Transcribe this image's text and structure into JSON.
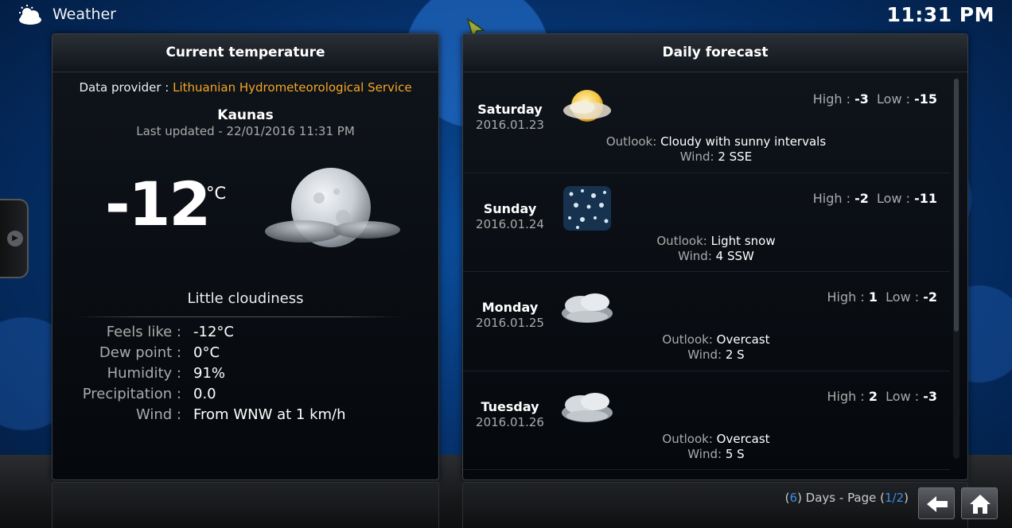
{
  "app": {
    "title": "Weather",
    "clock": "11:31 PM"
  },
  "current": {
    "panel_title": "Current temperature",
    "provider_label": "Data provider :",
    "provider_value": "Lithuanian Hydrometeorological Service",
    "city": "Kaunas",
    "last_updated": "Last updated - 22/01/2016 11:31 PM",
    "temperature": "-12",
    "unit": "°C",
    "condition": "Little cloudiness",
    "icon": "moon-cloud-icon",
    "details": [
      {
        "label": "Feels like :",
        "value": "-12°C"
      },
      {
        "label": "Dew point :",
        "value": "0°C"
      },
      {
        "label": "Humidity :",
        "value": "91%"
      },
      {
        "label": "Precipitation :",
        "value": "0.0"
      },
      {
        "label": "Wind :",
        "value": "From WNW at 1 km/h"
      }
    ]
  },
  "forecast": {
    "panel_title": "Daily forecast",
    "high_label": "High :",
    "low_label": "Low :",
    "outlook_label": "Outlook:",
    "wind_label": "Wind:",
    "days": [
      {
        "day": "Saturday",
        "date": "2016.01.23",
        "high": "-3",
        "low": "-15",
        "outlook": "Cloudy with sunny intervals",
        "wind": "2 SSE",
        "icon": "sun-cloud-icon"
      },
      {
        "day": "Sunday",
        "date": "2016.01.24",
        "high": "-2",
        "low": "-11",
        "outlook": "Light snow",
        "wind": "4 SSW",
        "icon": "snow-icon"
      },
      {
        "day": "Monday",
        "date": "2016.01.25",
        "high": "1",
        "low": "-2",
        "outlook": "Overcast",
        "wind": "2 S",
        "icon": "overcast-cloud-icon"
      },
      {
        "day": "Tuesday",
        "date": "2016.01.26",
        "high": "2",
        "low": "-3",
        "outlook": "Overcast",
        "wind": "5 S",
        "icon": "overcast-cloud-icon"
      }
    ]
  },
  "pager": {
    "open": "(",
    "count": "6",
    "middle": ") Days - Page (",
    "page": "1/2",
    "close": ")"
  },
  "colors": {
    "accent": "#f5a623",
    "pager_number": "#3a8ee6"
  }
}
